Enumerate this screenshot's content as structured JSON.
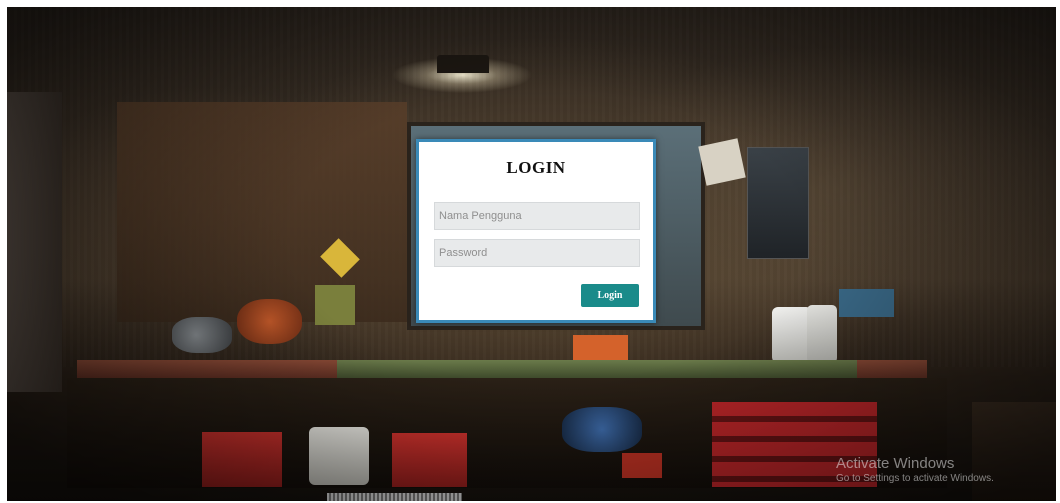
{
  "login": {
    "title": "LOGIN",
    "username_placeholder": "Nama Pengguna",
    "password_placeholder": "Password",
    "button_label": "Login"
  },
  "watermark": {
    "line1": "Activate Windows",
    "line2": "Go to Settings to activate Windows."
  },
  "colors": {
    "card_border": "#3a8ab8",
    "button": "#1a8b8a",
    "field_bg": "#e8eaeb"
  }
}
